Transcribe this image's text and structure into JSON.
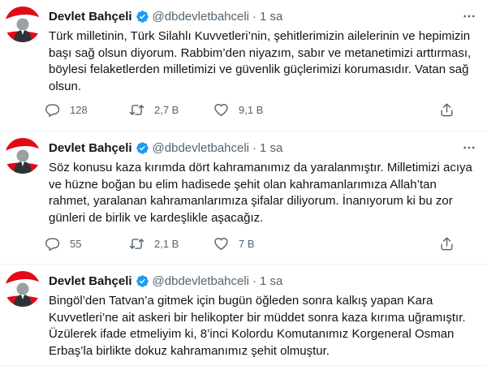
{
  "tweets": [
    {
      "name": "Devlet Bahçeli",
      "handle": "@dbdevletbahceli",
      "separator": "·",
      "time": "1 sa",
      "text": "Türk milletinin, Türk Silahlı Kuvvetleri’nin, şehitlerimizin ailelerinin ve hepimizin başı sağ olsun diyorum. Rabbim’den niyazım, sabır ve metanetimizi arttırması, böylesi felaketlerden milletimizi ve güvenlik güçlerimizi korumasıdır. Vatan sağ olsun.",
      "replies": "128",
      "retweets": "2,7 B",
      "likes": "9,1 B"
    },
    {
      "name": "Devlet Bahçeli",
      "handle": "@dbdevletbahceli",
      "separator": "·",
      "time": "1 sa",
      "text": "Söz konusu kaza kırımda dört kahramanımız da yaralanmıştır. Milletimizi acıya ve hüzne boğan bu elim hadisede şehit olan kahramanlarımıza Allah’tan rahmet, yaralanan kahramanlarımıza şifalar diliyorum. İnanıyorum ki bu zor günleri de birlik ve kardeşlikle aşacağız.",
      "replies": "55",
      "retweets": "2,1 B",
      "likes": "7 B"
    },
    {
      "name": "Devlet Bahçeli",
      "handle": "@dbdevletbahceli",
      "separator": "·",
      "time": "1 sa",
      "text": "Bingöl’den Tatvan’a gitmek için bugün öğleden sonra kalkış yapan Kara Kuvvetleri’ne ait askeri bir helikopter bir müddet sonra kaza kırıma uğramıştır. Üzülerek ifade etmeliyim ki, 8’inci Kolordu Komutanımız Korgeneral Osman Erbaş’la birlikte dokuz kahramanımız şehit olmuştur."
    }
  ],
  "icons": {
    "verified": "verified-badge-icon",
    "more": "more-icon",
    "reply": "reply-icon",
    "retweet": "retweet-icon",
    "like": "like-icon",
    "share": "share-icon"
  },
  "colors": {
    "verified": "#1d9bf0",
    "text": "#0f1419",
    "secondary": "#536471",
    "divider": "#eff3f4",
    "avatar_accent": "#e30a17"
  }
}
